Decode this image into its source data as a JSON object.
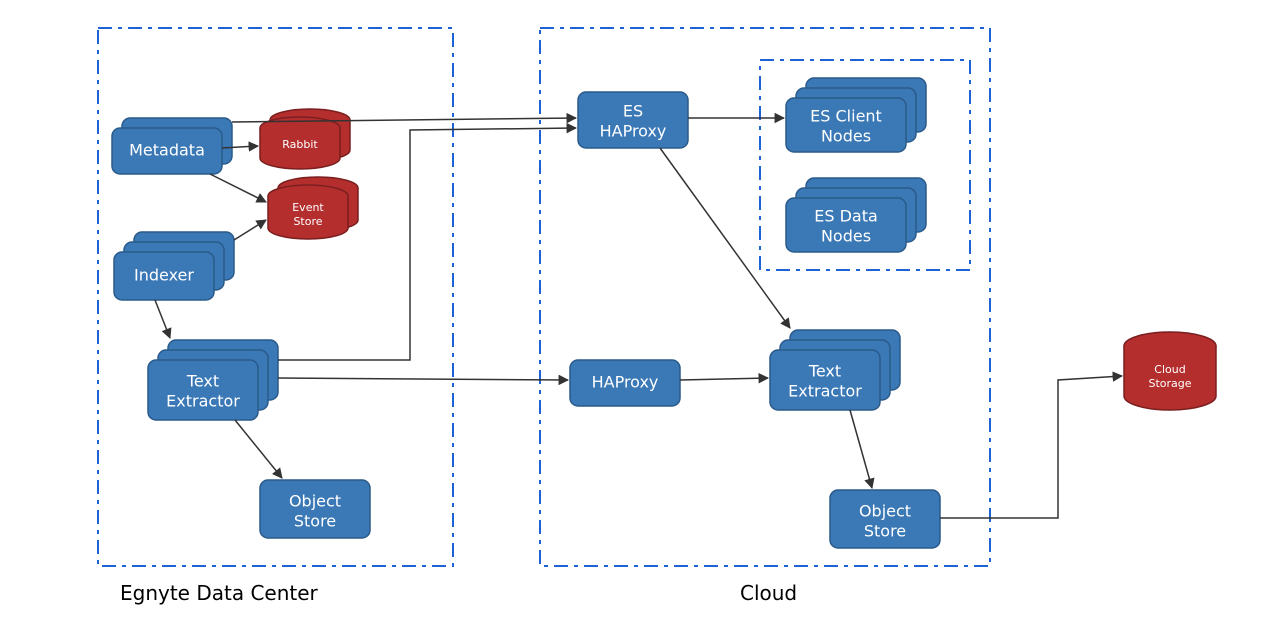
{
  "regions": {
    "datacenter": {
      "label": "Egnyte Data Center"
    },
    "cloud": {
      "label": "Cloud"
    },
    "es_cluster": {
      "label": ""
    }
  },
  "nodes": {
    "metadata": {
      "label": "Metadata"
    },
    "rabbit": {
      "label": "Rabbit"
    },
    "event_store": {
      "label1": "Event",
      "label2": "Store"
    },
    "indexer": {
      "label": "Indexer"
    },
    "text_extractor_dc": {
      "label1": "Text",
      "label2": "Extractor"
    },
    "object_store_dc": {
      "label1": "Object",
      "label2": "Store"
    },
    "es_haproxy": {
      "label1": "ES",
      "label2": "HAProxy"
    },
    "haproxy": {
      "label": "HAProxy"
    },
    "text_extractor_cl": {
      "label1": "Text",
      "label2": "Extractor"
    },
    "object_store_cl": {
      "label1": "Object",
      "label2": "Store"
    },
    "es_client_nodes": {
      "label1": "ES Client",
      "label2": "Nodes"
    },
    "es_data_nodes": {
      "label1": "ES Data",
      "label2": "Nodes"
    },
    "cloud_storage": {
      "label1": "Cloud",
      "label2": "Storage"
    }
  },
  "colors": {
    "box_fill": "#3a78b6",
    "box_stroke": "#2a5a8a",
    "cyl_fill": "#b52e2e",
    "cyl_stroke": "#7a1f1f",
    "dash": "#1e63d6",
    "arrow": "#333333"
  }
}
